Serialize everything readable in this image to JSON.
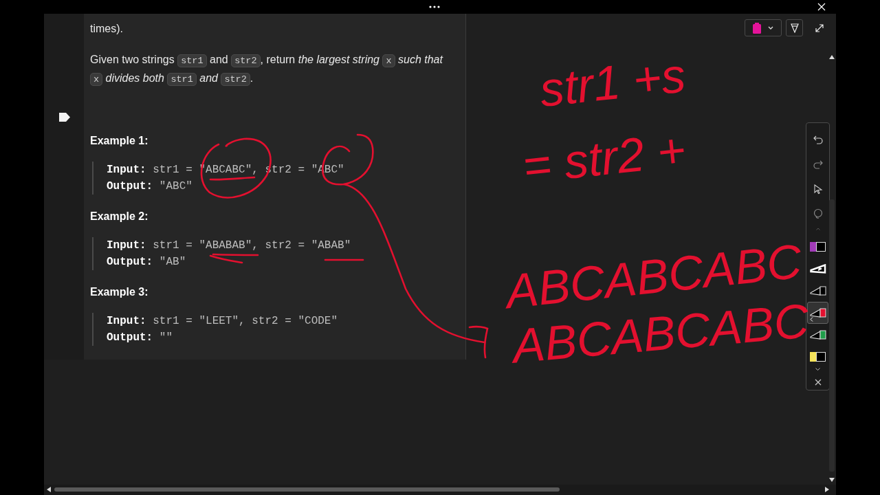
{
  "problem": {
    "paragraphs": [
      [
        {
          "kind": "text",
          "text": "times)."
        }
      ],
      [
        {
          "kind": "text",
          "text": "Given two strings "
        },
        {
          "kind": "code",
          "text": "str1"
        },
        {
          "kind": "text",
          "text": " and "
        },
        {
          "kind": "code",
          "text": "str2"
        },
        {
          "kind": "text",
          "text": ", return "
        },
        {
          "kind": "italic",
          "text": "the largest string "
        },
        {
          "kind": "code",
          "text": "x"
        },
        {
          "kind": "italic",
          "text": " such that "
        },
        {
          "kind": "code",
          "text": "x"
        },
        {
          "kind": "italic",
          "text": " divides both "
        },
        {
          "kind": "code",
          "text": "str1"
        },
        {
          "kind": "italic",
          "text": " and "
        },
        {
          "kind": "code",
          "text": "str2"
        },
        {
          "kind": "text",
          "text": "."
        }
      ]
    ]
  },
  "examples": [
    {
      "title": "Example 1:",
      "input_label": "Input:",
      "input": "str1 = \"ABCABC\", str2 = \"ABC\"",
      "output_label": "Output:",
      "output": "\"ABC\""
    },
    {
      "title": "Example 2:",
      "input_label": "Input:",
      "input": "str1 = \"ABABAB\", str2 = \"ABAB\"",
      "output_label": "Output:",
      "output": "\"AB\""
    },
    {
      "title": "Example 3:",
      "input_label": "Input:",
      "input": "str1 = \"LEET\", str2 = \"CODE\"",
      "output_label": "Output:",
      "output": "\"\""
    }
  ],
  "ink_notes": [
    {
      "text": "str1 +s"
    },
    {
      "text": "= str2 +"
    },
    {
      "text": "ABCABCABC"
    },
    {
      "text": "ABCABCABC"
    }
  ],
  "top_toolbar": {
    "color": "#e4139a"
  },
  "ink_toolbar": {
    "tools": [
      {
        "kind": "undo"
      },
      {
        "kind": "redo"
      },
      {
        "kind": "select"
      },
      {
        "kind": "lasso"
      }
    ],
    "pens": [
      {
        "kind": "highlighter",
        "color": "#a23cb8",
        "selected": false
      },
      {
        "kind": "calligraphy",
        "color": "#ffffff",
        "selected": false
      },
      {
        "kind": "pen",
        "color": "#000000",
        "selected": false
      },
      {
        "kind": "pen",
        "color": "#e3102f",
        "selected": true
      },
      {
        "kind": "pen",
        "color": "#1f9d4a",
        "selected": false
      },
      {
        "kind": "highlighter",
        "color": "#f3e25a",
        "selected": false
      }
    ]
  }
}
